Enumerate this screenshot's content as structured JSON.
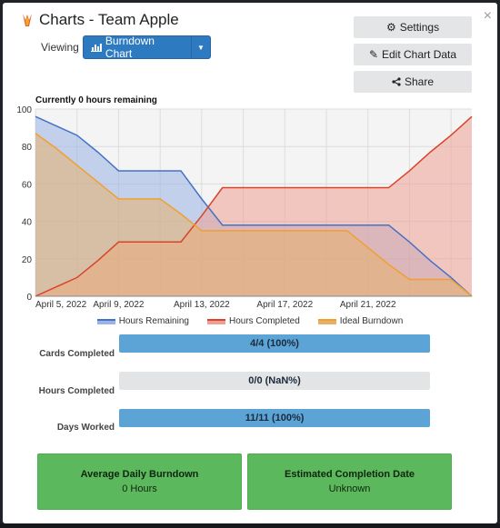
{
  "header": {
    "title": "Charts - Team Apple",
    "viewing_label": "Viewing",
    "chart_select": "Burndown Chart",
    "close": "×"
  },
  "actions": {
    "settings": "Settings",
    "edit": "Edit Chart Data",
    "share": "Share"
  },
  "chart_data": {
    "type": "area",
    "title": "Currently 0 hours remaining",
    "ylim": [
      0,
      100
    ],
    "yticks": [
      0,
      20,
      40,
      60,
      80,
      100
    ],
    "xticks": [
      "April 5, 2022",
      "April 9, 2022",
      "April 13, 2022",
      "April 17, 2022",
      "April 21, 2022"
    ],
    "x": [
      "2022-04-05",
      "2022-04-06",
      "2022-04-07",
      "2022-04-08",
      "2022-04-09",
      "2022-04-10",
      "2022-04-11",
      "2022-04-12",
      "2022-04-13",
      "2022-04-14",
      "2022-04-15",
      "2022-04-16",
      "2022-04-17",
      "2022-04-18",
      "2022-04-19",
      "2022-04-20",
      "2022-04-21",
      "2022-04-22",
      "2022-04-23",
      "2022-04-24",
      "2022-04-25",
      "2022-04-26"
    ],
    "series": [
      {
        "name": "Hours Remaining",
        "color": "#4472c4",
        "fill": "#9bb3e6",
        "values": [
          96,
          91,
          86,
          77,
          67,
          67,
          67,
          67,
          52,
          38,
          38,
          38,
          38,
          38,
          38,
          38,
          38,
          38,
          29,
          19,
          10,
          0
        ]
      },
      {
        "name": "Hours Completed",
        "color": "#d9432a",
        "fill": "#efa094",
        "values": [
          0,
          5,
          10,
          19,
          29,
          29,
          29,
          29,
          43,
          58,
          58,
          58,
          58,
          58,
          58,
          58,
          58,
          58,
          67,
          77,
          86,
          96
        ]
      },
      {
        "name": "Ideal Burndown",
        "color": "#f0a030",
        "fill": "#e6b06a",
        "values": [
          87,
          79,
          70,
          61,
          52,
          52,
          52,
          44,
          35,
          35,
          35,
          35,
          35,
          35,
          35,
          35,
          26,
          17,
          9,
          9,
          9,
          0
        ]
      }
    ]
  },
  "stats": [
    {
      "label": "Cards Completed",
      "value": "4/4 (100%)",
      "fraction": 1.0
    },
    {
      "label": "Hours Completed",
      "value": "0/0 (NaN%)",
      "fraction": 0
    },
    {
      "label": "Days Worked",
      "value": "11/11 (100%)",
      "fraction": 1.0
    }
  ],
  "cards": [
    {
      "head": "Average Daily Burndown",
      "value": "0 Hours"
    },
    {
      "head": "Estimated Completion Date",
      "value": "Unknown"
    }
  ]
}
